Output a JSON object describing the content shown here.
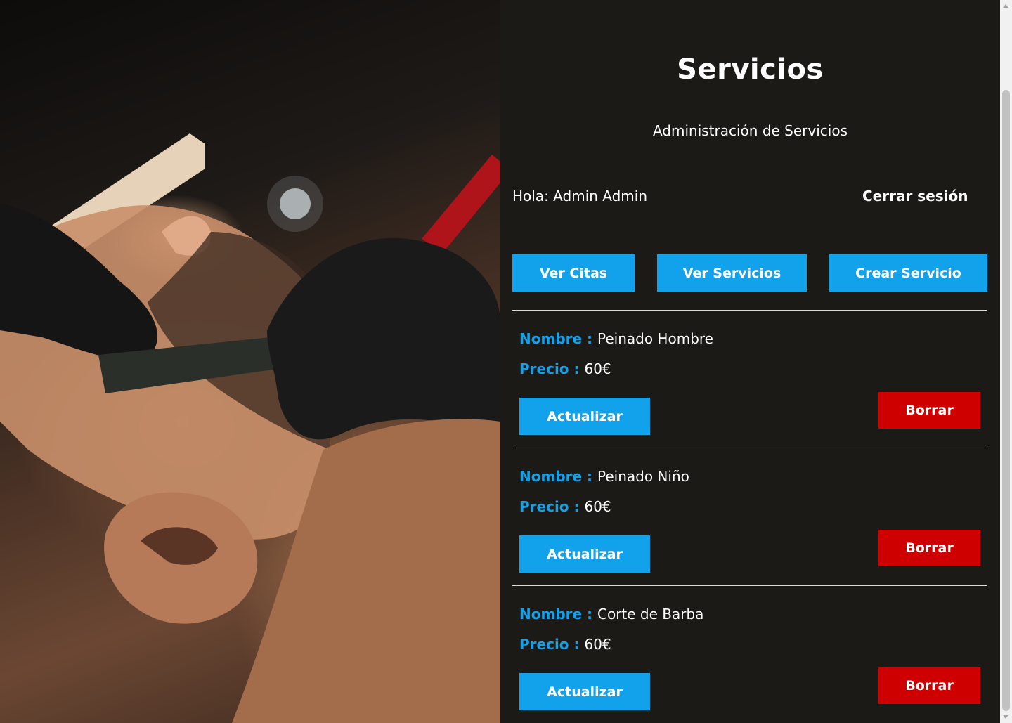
{
  "header": {
    "title": "Servicios",
    "subtitle": "Administración de Servicios"
  },
  "user": {
    "greeting": "Hola: Admin Admin",
    "logout_label": "Cerrar sesión"
  },
  "nav": {
    "ver_citas": "Ver Citas",
    "ver_servicios": "Ver Servicios",
    "crear_servicio": "Crear Servicio"
  },
  "labels": {
    "nombre": "Nombre :",
    "precio": "Precio :",
    "actualizar": "Actualizar",
    "borrar": "Borrar"
  },
  "services": [
    {
      "nombre": "Peinado Hombre",
      "precio": "60€"
    },
    {
      "nombre": "Peinado Niño",
      "precio": "60€"
    },
    {
      "nombre": "Corte de Barba",
      "precio": "60€"
    }
  ],
  "colors": {
    "background": "#1b1a16",
    "accent_blue": "#12a2ec",
    "danger_red": "#cf0000"
  },
  "hero_image": "barber-shaving-photo"
}
